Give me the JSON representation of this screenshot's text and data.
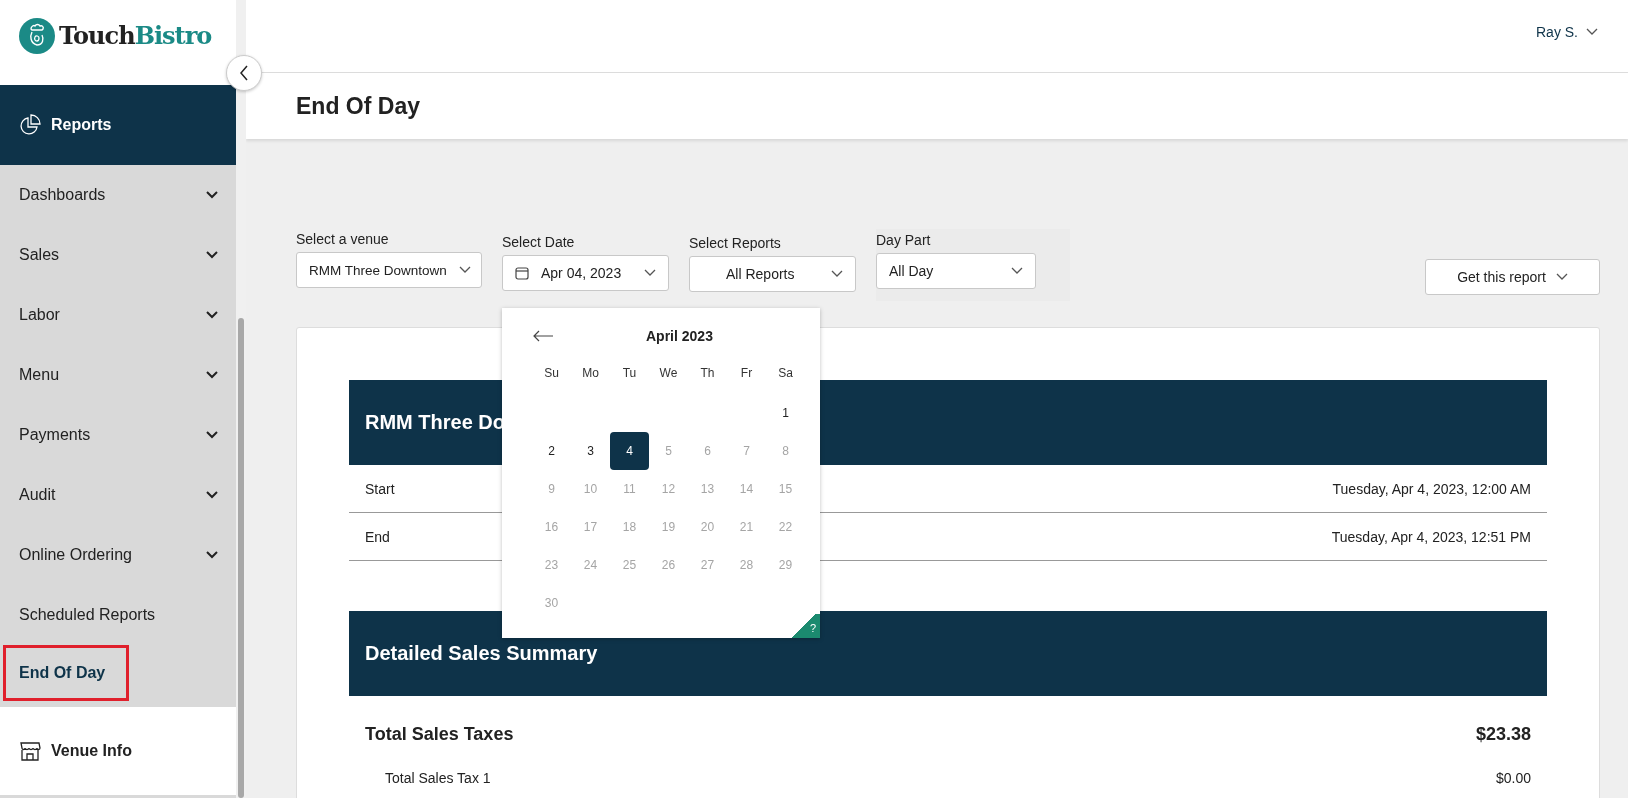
{
  "brand": {
    "name_dark": "Touch",
    "name_accent": "Bistro"
  },
  "sidebar": {
    "section": "Reports",
    "items": [
      {
        "label": "Dashboards",
        "kind": "group",
        "selected": false
      },
      {
        "label": "Sales",
        "kind": "group",
        "selected": false
      },
      {
        "label": "Labor",
        "kind": "group",
        "selected": false
      },
      {
        "label": "Menu",
        "kind": "group",
        "selected": false
      },
      {
        "label": "Payments",
        "kind": "group",
        "selected": false
      },
      {
        "label": "Audit",
        "kind": "group",
        "selected": false
      },
      {
        "label": "Online Ordering",
        "kind": "group",
        "selected": false
      },
      {
        "label": "Scheduled Reports",
        "kind": "link",
        "selected": false
      },
      {
        "label": "End Of Day",
        "kind": "link",
        "selected": true
      }
    ],
    "footer": "Venue Info"
  },
  "user": "Ray S.",
  "page_title": "End Of Day",
  "filters": [
    {
      "label": "Select a venue",
      "value": "RMM Three Downtown",
      "kind": "select"
    },
    {
      "label": "Select Date",
      "value": "Apr 04, 2023",
      "kind": "date"
    },
    {
      "label": "Select Reports",
      "value": "All Reports",
      "kind": "select"
    },
    {
      "label": "Day Part",
      "value": "All Day",
      "kind": "select"
    }
  ],
  "report_button": "Get this report",
  "calendar": {
    "month": "April 2023",
    "weekdays": [
      "Su",
      "Mo",
      "Tu",
      "We",
      "Th",
      "Fr",
      "Sa"
    ],
    "weeks": [
      {
        "days": [
          {
            "day": "1",
            "disabled": false,
            "selected": false
          }
        ]
      },
      {
        "days": [
          {
            "day": "2",
            "disabled": false,
            "selected": false
          },
          {
            "day": "3",
            "disabled": false,
            "selected": false
          },
          {
            "day": "4",
            "disabled": false,
            "selected": true
          },
          {
            "day": "5",
            "disabled": true,
            "selected": false
          },
          {
            "day": "6",
            "disabled": true,
            "selected": false
          },
          {
            "day": "7",
            "disabled": true,
            "selected": false
          },
          {
            "day": "8",
            "disabled": true,
            "selected": false
          }
        ]
      },
      {
        "days": [
          {
            "day": "9",
            "disabled": true,
            "selected": false
          },
          {
            "day": "10",
            "disabled": true,
            "selected": false
          },
          {
            "day": "11",
            "disabled": true,
            "selected": false
          },
          {
            "day": "12",
            "disabled": true,
            "selected": false
          },
          {
            "day": "13",
            "disabled": true,
            "selected": false
          },
          {
            "day": "14",
            "disabled": true,
            "selected": false
          },
          {
            "day": "15",
            "disabled": true,
            "selected": false
          }
        ]
      },
      {
        "days": [
          {
            "day": "16",
            "disabled": true,
            "selected": false
          },
          {
            "day": "17",
            "disabled": true,
            "selected": false
          },
          {
            "day": "18",
            "disabled": true,
            "selected": false
          },
          {
            "day": "19",
            "disabled": true,
            "selected": false
          },
          {
            "day": "20",
            "disabled": true,
            "selected": false
          },
          {
            "day": "21",
            "disabled": true,
            "selected": false
          },
          {
            "day": "22",
            "disabled": true,
            "selected": false
          }
        ]
      },
      {
        "days": [
          {
            "day": "23",
            "disabled": true,
            "selected": false
          },
          {
            "day": "24",
            "disabled": true,
            "selected": false
          },
          {
            "day": "25",
            "disabled": true,
            "selected": false
          },
          {
            "day": "26",
            "disabled": true,
            "selected": false
          },
          {
            "day": "27",
            "disabled": true,
            "selected": false
          },
          {
            "day": "28",
            "disabled": true,
            "selected": false
          },
          {
            "day": "29",
            "disabled": true,
            "selected": false
          }
        ]
      },
      {
        "days": [
          {
            "day": "30",
            "disabled": true,
            "selected": false
          }
        ]
      }
    ],
    "help": "?"
  },
  "report": {
    "venue_banner": "RMM Three Do",
    "rows": [
      {
        "label": "Start",
        "value": "Tuesday, Apr 4, 2023, 12:00 AM"
      },
      {
        "label": "End",
        "value": "Tuesday, Apr 4, 2023, 12:51 PM"
      }
    ],
    "section_banner": "Detailed Sales Summary",
    "lines": [
      {
        "label": "Total Sales Taxes",
        "value": "$23.38",
        "kind": "total"
      },
      {
        "label": "Total Sales Tax 1",
        "value": "$0.00",
        "kind": "sub"
      }
    ]
  }
}
